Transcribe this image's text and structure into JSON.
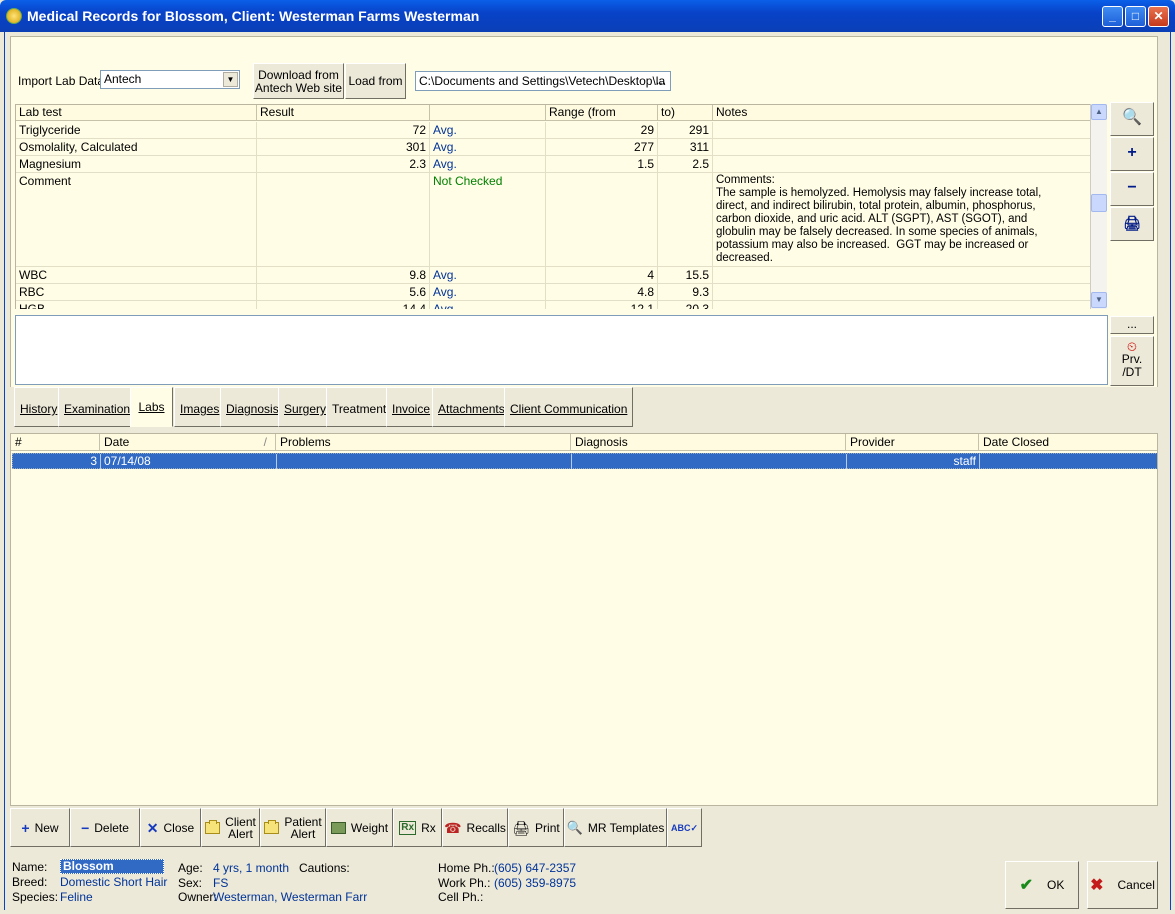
{
  "window": {
    "title": "Medical Records for Blossom,  Client: Westerman Farms Westerman",
    "minimize": "_",
    "maximize": "□",
    "close": "✕"
  },
  "labs": {
    "import_label": "Import Lab Data",
    "provider": "Antech",
    "download_button": "Download from Antech Web site",
    "download_line1": "Download from",
    "download_line2": "Antech Web site",
    "load_button": "Load from",
    "path": "C:\\Documents and Settings\\Vetech\\Desktop\\la",
    "path_button": "...",
    "columns": [
      "Lab test",
      "Result",
      "",
      "Range (from",
      "to)",
      "Notes"
    ],
    "rows": [
      {
        "test": "Triglyceride",
        "result": "72",
        "flag": "Avg.",
        "from": "29",
        "to": "291",
        "notes": ""
      },
      {
        "test": "Osmolality, Calculated",
        "result": "301",
        "flag": "Avg.",
        "from": "277",
        "to": "311",
        "notes": ""
      },
      {
        "test": "Magnesium",
        "result": "2.3",
        "flag": "Avg.",
        "from": "1.5",
        "to": "2.5",
        "notes": ""
      },
      {
        "test": "Comment",
        "result": "",
        "flag": "Not Checked",
        "from": "",
        "to": "",
        "notes": "Comments:\nThe sample is hemolyzed. Hemolysis may falsely increase total, direct, and indirect bilirubin, total protein, albumin, phosphorus, carbon dioxide, and uric acid. ALT (SGPT), AST (SGOT), and globulin may be falsely decreased. In some species of animals, potassium may also be increased.  GGT may be increased or decreased."
      },
      {
        "test": "WBC",
        "result": "9.8",
        "flag": "Avg.",
        "from": "4",
        "to": "15.5",
        "notes": ""
      },
      {
        "test": "RBC",
        "result": "5.6",
        "flag": "Avg.",
        "from": "4.8",
        "to": "9.3",
        "notes": ""
      },
      {
        "test": "HGB",
        "result": "14.4",
        "flag": "Avg.",
        "from": "12.1",
        "to": "20.3",
        "notes": ""
      }
    ],
    "side_ellipsis": "...",
    "prv_label": "Prv.",
    "dt_label": "/DT"
  },
  "tabs": [
    "History",
    "Examinations",
    "Labs",
    "Images",
    "Diagnosis",
    "Surgery",
    "Treatment",
    "Invoice",
    "Attachments",
    "Client Communication"
  ],
  "active_tab": "Labs",
  "records": {
    "columns": [
      "#",
      "Date",
      "Problems",
      "Diagnosis",
      "Provider",
      "Date Closed"
    ],
    "sort_indicator": "/",
    "rows": [
      {
        "num": "3",
        "date": "07/14/08",
        "problems": "",
        "diagnosis": "",
        "provider": "staff",
        "date_closed": ""
      }
    ]
  },
  "toolbar": {
    "new": "New",
    "delete": "Delete",
    "close": "Close",
    "client_alert_1": "Client",
    "client_alert_2": "Alert",
    "patient_alert_1": "Patient",
    "patient_alert_2": "Alert",
    "weight": "Weight",
    "rx": "Rx",
    "recalls": "Recalls",
    "print": "Print",
    "mr_templates": "MR Templates"
  },
  "patient": {
    "name_label": "Name:",
    "name": "Blossom",
    "breed_label": "Breed:",
    "breed": "Domestic Short Hair",
    "species_label": "Species:",
    "species": "Feline",
    "age_label": "Age:",
    "age": "4 yrs, 1 month",
    "sex_label": "Sex:",
    "sex": "FS",
    "owner_label": "Owner:",
    "owner": "Westerman, Westerman Farr",
    "cautions_label": "Cautions:",
    "home_label": "Home Ph.:",
    "home": "(605) 647-2357",
    "work_label": "Work Ph.:",
    "work": "(605) 359-8975",
    "cell_label": "Cell Ph.:",
    "cell": ""
  },
  "dialog": {
    "ok": "OK",
    "cancel": "Cancel"
  }
}
